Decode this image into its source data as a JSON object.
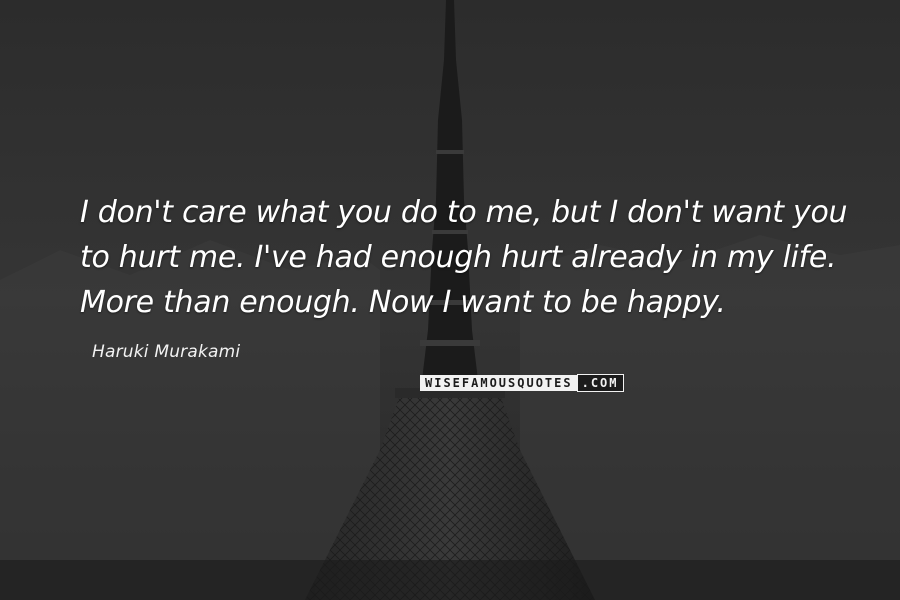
{
  "quote": {
    "text": "I don't care what you do to me, but I don't want you to hurt me. I've had enough hurt already in my life. More than enough. Now I want to be happy.",
    "author": "Haruki Murakami"
  },
  "watermark": {
    "main": "WISEFAMOUSQUOTES",
    "suffix": ".COM"
  },
  "colors": {
    "text": "#ffffff",
    "background": "#2a2a2a"
  }
}
